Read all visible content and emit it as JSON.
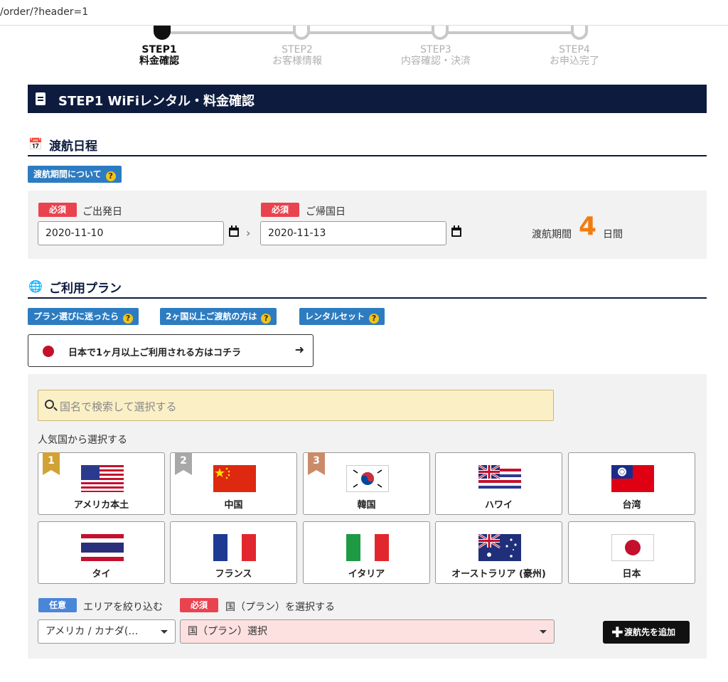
{
  "browser": {
    "url": "/order/?header=1"
  },
  "steps": [
    {
      "step": "STEP1",
      "label": "料金確認"
    },
    {
      "step": "STEP2",
      "label": "お客様情報"
    },
    {
      "step": "STEP3",
      "label": "内容確認・決済"
    },
    {
      "step": "STEP4",
      "label": "お申込完了"
    }
  ],
  "page_title": "STEP1 WiFiレンタル・料金確認",
  "schedule": {
    "heading": "渡航日程",
    "about_button": "渡航期間について",
    "required_badge": "必須",
    "departure_label": "ご出発日",
    "departure_value": "2020-11-10",
    "separator": "›",
    "return_label": "ご帰国日",
    "return_value": "2020-11-13",
    "duration_label": "渡航期間",
    "duration_days": "4",
    "duration_unit": "日間"
  },
  "plan": {
    "heading": "ご利用プラン",
    "help_buttons": [
      "プラン選びに迷ったら",
      "2ヶ国以上ご渡航の方は",
      "レンタルセット"
    ],
    "question_mark": "?",
    "long_stay_text": "日本で1ヶ月以上ご利用される方はコチラ",
    "long_stay_arrow": "➜"
  },
  "country_select": {
    "search_placeholder": "国名で検索して選択する",
    "popular_label": "人気国から選択する",
    "countries": [
      {
        "name": "アメリカ本土",
        "rank": "1",
        "flag": "us-flag"
      },
      {
        "name": "中国",
        "rank": "2",
        "flag": "china-flag"
      },
      {
        "name": "韓国",
        "rank": "3",
        "flag": "korea-flag"
      },
      {
        "name": "ハワイ",
        "rank": "",
        "flag": "hawaii-flag"
      },
      {
        "name": "台湾",
        "rank": "",
        "flag": "taiwan-flag"
      },
      {
        "name": "タイ",
        "rank": "",
        "flag": "thailand-flag"
      },
      {
        "name": "フランス",
        "rank": "",
        "flag": "france-flag"
      },
      {
        "name": "イタリア",
        "rank": "",
        "flag": "italy-flag"
      },
      {
        "name": "オーストラリア (豪州)",
        "rank": "",
        "flag": "australia-flag"
      },
      {
        "name": "日本",
        "rank": "",
        "flag": "japan-flag"
      }
    ],
    "optional_badge": "任意",
    "area_label": "エリアを絞り込む",
    "required_badge": "必須",
    "country_label": "国（プラン）を選択する",
    "area_value": "アメリカ / カナダ(…",
    "country_value": "国（プラン）選択",
    "add_button": "渡航先を追加",
    "add_plus": "✚"
  },
  "colors": {
    "navy": "#0d1b3e",
    "required": "#e9434f",
    "optional": "#4a86d8",
    "info": "#2d7cc1",
    "accent": "#f07c10"
  }
}
